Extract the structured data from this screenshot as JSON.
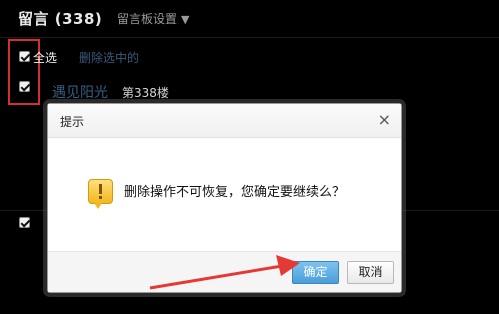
{
  "header": {
    "title": "留言 (338)",
    "settings_label": "留言板设置",
    "settings_caret": "▼"
  },
  "toolbar": {
    "select_all": "全选",
    "delete_selected": "删除选中的"
  },
  "comment": {
    "author": "遇见阳光",
    "floor": "第338楼"
  },
  "dialog": {
    "title": "提示",
    "close": "×",
    "message": "删除操作不可恢复，您确定要继续么？",
    "ok_label": "确定",
    "cancel_label": "取消"
  },
  "colors": {
    "highlight_box": "#d32f2f",
    "arrow": "#e53935",
    "ok_button": "#4a9ed8"
  }
}
